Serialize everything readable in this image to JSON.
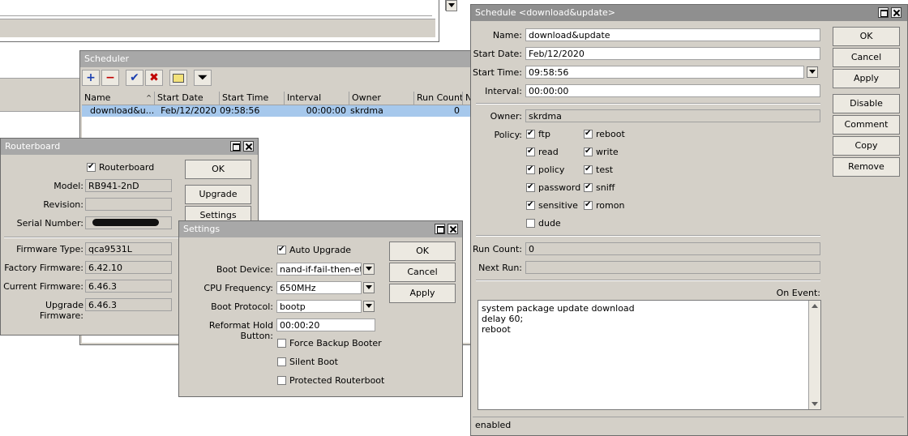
{
  "scheduler": {
    "title": "Scheduler",
    "columns": [
      "Name",
      "Start Date",
      "Start Time",
      "Interval",
      "Owner",
      "Run Count",
      "N"
    ],
    "rows": [
      {
        "name": "download&u...",
        "start_date": "Feb/12/2020",
        "start_time": "09:58:56",
        "interval": "00:00:00",
        "owner": "skrdma",
        "run_count": "0"
      }
    ]
  },
  "routerboard": {
    "title": "Routerboard",
    "routerboard_checkbox": "Routerboard",
    "model_label": "Model:",
    "model": "RB941-2nD",
    "revision_label": "Revision:",
    "revision": "",
    "serial_label": "Serial Number:",
    "firmware_type_label": "Firmware Type:",
    "firmware_type": "qca9531L",
    "factory_fw_label": "Factory Firmware:",
    "factory_fw": "6.42.10",
    "current_fw_label": "Current Firmware:",
    "current_fw": "6.46.3",
    "upgrade_fw_label": "Upgrade Firmware:",
    "upgrade_fw": "6.46.3",
    "ok": "OK",
    "upgrade": "Upgrade",
    "settings": "Settings"
  },
  "settings": {
    "title": "Settings",
    "auto_upgrade": "Auto Upgrade",
    "boot_device_label": "Boot Device:",
    "boot_device": "nand-if-fail-then-ethe",
    "cpu_freq_label": "CPU Frequency:",
    "cpu_freq": "650MHz",
    "boot_protocol_label": "Boot Protocol:",
    "boot_protocol": "bootp",
    "reformat_label": "Reformat Hold Button:",
    "reformat": "00:00:20",
    "force_backup": "Force Backup Booter",
    "silent_boot": "Silent Boot",
    "protected_rb": "Protected Routerboot",
    "ok": "OK",
    "cancel": "Cancel",
    "apply": "Apply"
  },
  "schedule": {
    "title": "Schedule <download&update>",
    "name_label": "Name:",
    "name": "download&update",
    "start_date_label": "Start Date:",
    "start_date": "Feb/12/2020",
    "start_time_label": "Start Time:",
    "start_time": "09:58:56",
    "interval_label": "Interval:",
    "interval": "00:00:00",
    "owner_label": "Owner:",
    "owner": "skrdma",
    "policy_label": "Policy:",
    "policies": [
      "ftp",
      "reboot",
      "read",
      "write",
      "policy",
      "test",
      "password",
      "sniff",
      "sensitive",
      "romon",
      "dude"
    ],
    "run_count_label": "Run Count:",
    "run_count": "0",
    "next_run_label": "Next Run:",
    "next_run": "",
    "on_event_label": "On Event:",
    "on_event": [
      "system package update download",
      "delay 60;",
      "reboot"
    ],
    "status": "enabled",
    "buttons": {
      "ok": "OK",
      "cancel": "Cancel",
      "apply": "Apply",
      "disable": "Disable",
      "comment": "Comment",
      "copy": "Copy",
      "remove": "Remove"
    }
  }
}
